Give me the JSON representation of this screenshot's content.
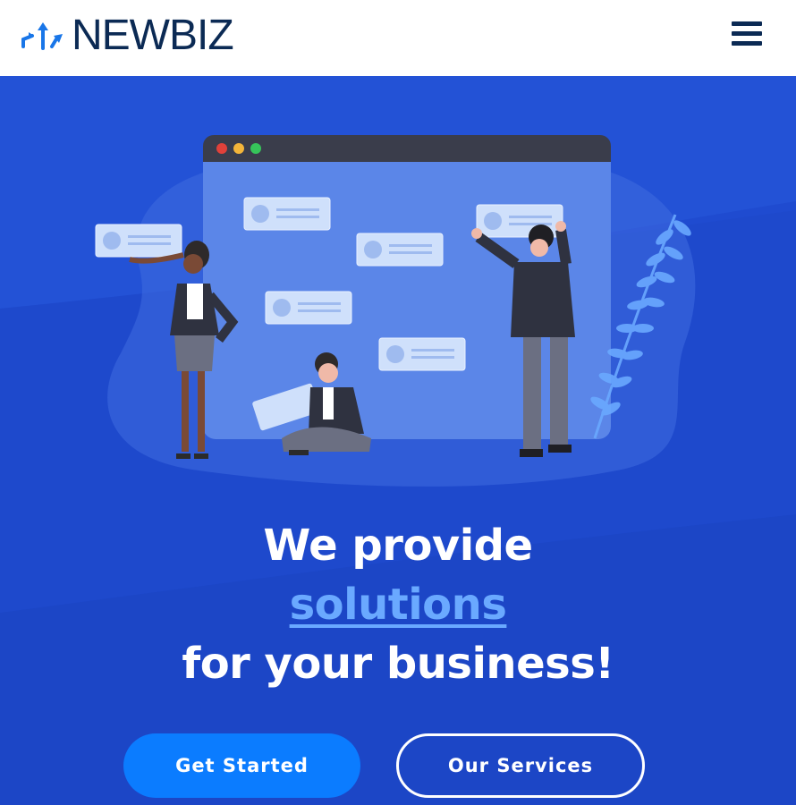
{
  "header": {
    "brand": "NEWBIZ",
    "logo_icon": "arrows-logo-icon",
    "menu_icon": "hamburger-menu-icon"
  },
  "hero": {
    "headline_line1": "We provide",
    "headline_accent": "solutions",
    "headline_line3": "for your business!",
    "primary_button": "Get Started",
    "secondary_button": "Our Services",
    "illustration": "team-collaboration-board-illustration"
  },
  "colors": {
    "brand_dark": "#0b2a54",
    "hero_bg": "#1f4bd0",
    "accent": "#6aa9ff",
    "primary_button": "#0b7cff"
  }
}
